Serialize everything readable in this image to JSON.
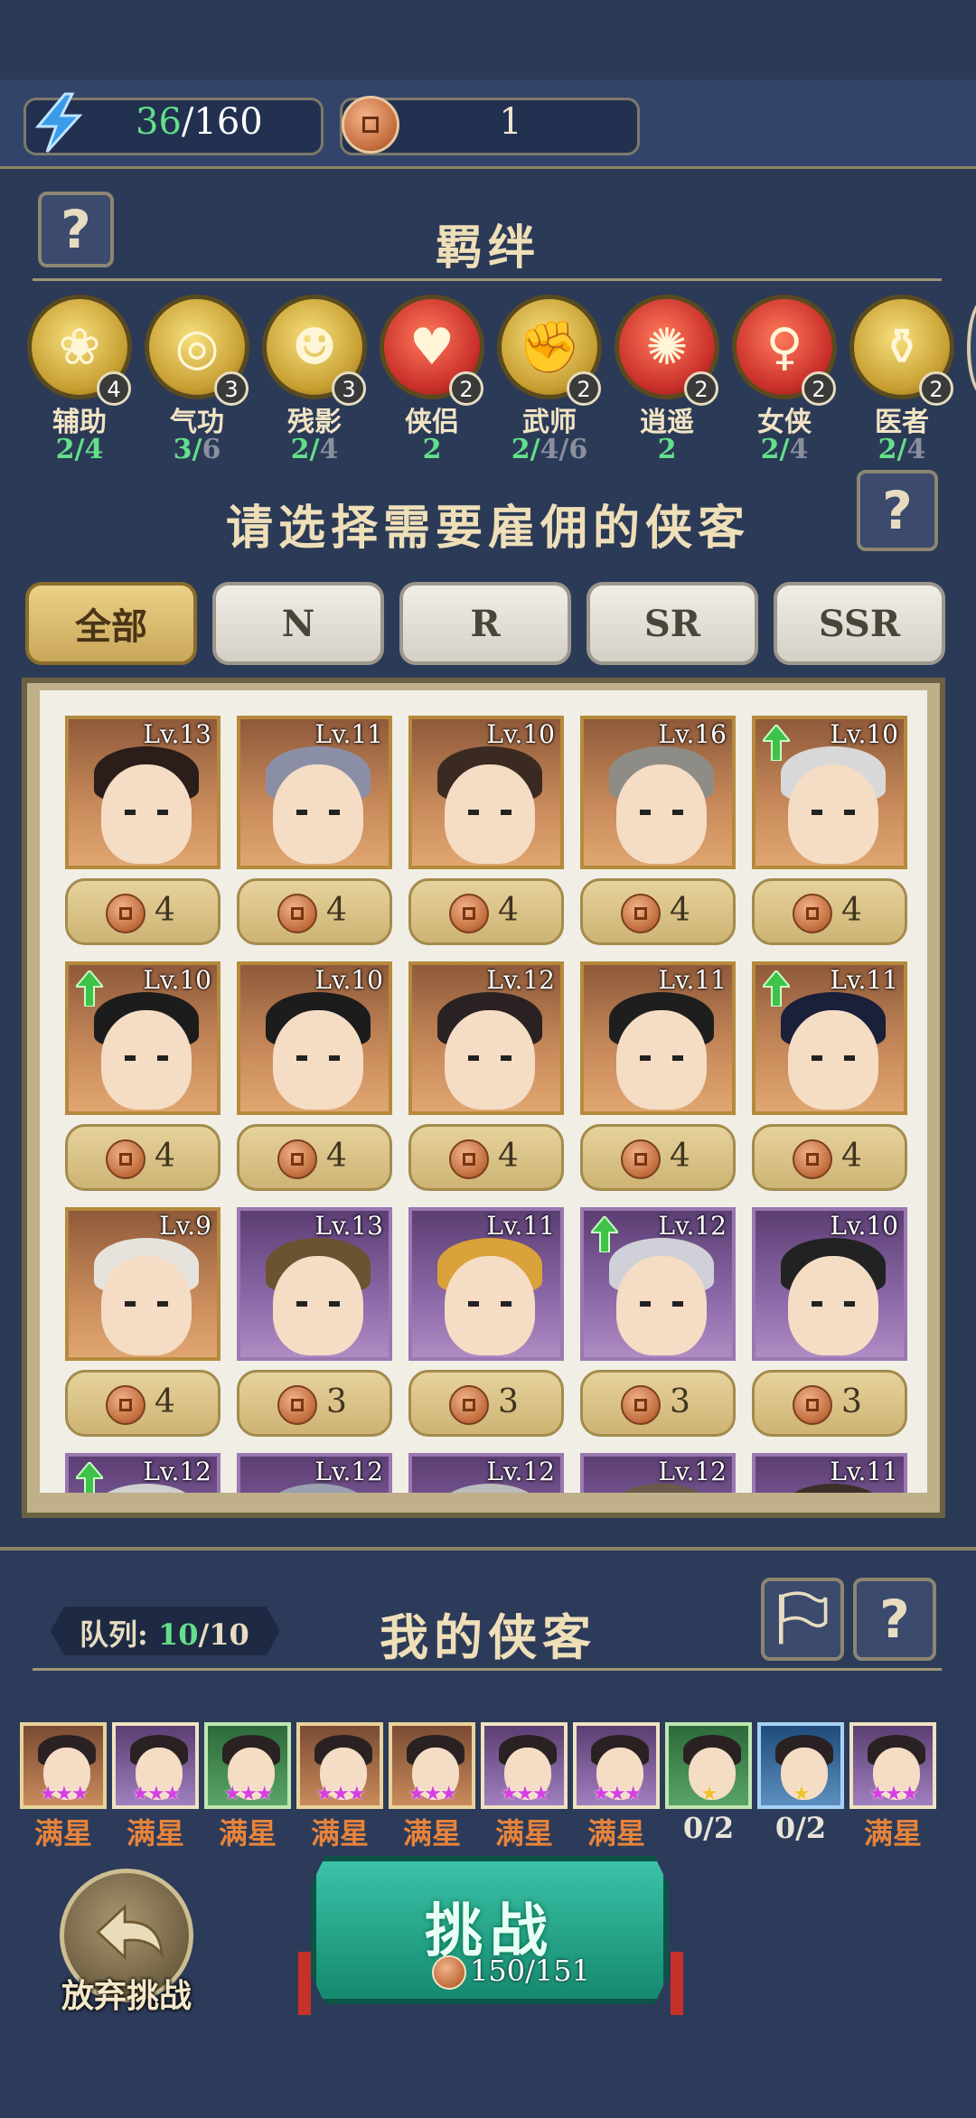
{
  "resources": {
    "energy_current": "36",
    "energy_max": "/160",
    "coins": "1"
  },
  "bonds": {
    "title": "羁绊",
    "items": [
      {
        "name": "辅助",
        "count": "4",
        "progress": "2/4",
        "dim": "",
        "color": "gold",
        "glyph": "❀"
      },
      {
        "name": "气功",
        "count": "3",
        "progress": "3/",
        "dim": "6",
        "color": "gold",
        "glyph": "◎"
      },
      {
        "name": "残影",
        "count": "3",
        "progress": "2/",
        "dim": "4",
        "color": "gold",
        "glyph": "☻"
      },
      {
        "name": "侠侣",
        "count": "2",
        "progress": "2",
        "dim": "",
        "color": "red",
        "glyph": "♥"
      },
      {
        "name": "武师",
        "count": "2",
        "progress": "2/",
        "dim": "4/6",
        "color": "gold",
        "glyph": "✊"
      },
      {
        "name": "逍遥",
        "count": "2",
        "progress": "2",
        "dim": "",
        "color": "red",
        "glyph": "✺"
      },
      {
        "name": "女侠",
        "count": "2",
        "progress": "2/",
        "dim": "4",
        "color": "red",
        "glyph": "♀"
      },
      {
        "name": "医者",
        "count": "2",
        "progress": "2/",
        "dim": "4",
        "color": "gold",
        "glyph": "⚱"
      }
    ]
  },
  "hire": {
    "title": "请选择需要雇佣的侠客",
    "tabs": [
      "全部",
      "N",
      "R",
      "SR",
      "SSR"
    ],
    "active_tab": "全部"
  },
  "heroes": [
    {
      "lv": "Lv.13",
      "price": "4",
      "rarity": "orange",
      "up": false,
      "hair": "#2a1d1a"
    },
    {
      "lv": "Lv.11",
      "price": "4",
      "rarity": "orange",
      "up": false,
      "hair": "#8b8fa6"
    },
    {
      "lv": "Lv.10",
      "price": "4",
      "rarity": "orange",
      "up": false,
      "hair": "#3a2a22"
    },
    {
      "lv": "Lv.16",
      "price": "4",
      "rarity": "orange",
      "up": false,
      "hair": "#8e8c86"
    },
    {
      "lv": "Lv.10",
      "price": "4",
      "rarity": "orange",
      "up": true,
      "hair": "#d8d8d8"
    },
    {
      "lv": "Lv.10",
      "price": "4",
      "rarity": "orange",
      "up": true,
      "hair": "#1c1c1c"
    },
    {
      "lv": "Lv.10",
      "price": "4",
      "rarity": "orange",
      "up": false,
      "hair": "#1c1c1c"
    },
    {
      "lv": "Lv.12",
      "price": "4",
      "rarity": "orange",
      "up": false,
      "hair": "#2a2222"
    },
    {
      "lv": "Lv.11",
      "price": "4",
      "rarity": "orange",
      "up": false,
      "hair": "#1e1e1e"
    },
    {
      "lv": "Lv.11",
      "price": "4",
      "rarity": "orange",
      "up": true,
      "hair": "#1a1f3a"
    },
    {
      "lv": "Lv.9",
      "price": "4",
      "rarity": "orange",
      "up": false,
      "hair": "#e6e3dc"
    },
    {
      "lv": "Lv.13",
      "price": "3",
      "rarity": "purple",
      "up": false,
      "hair": "#6b5230"
    },
    {
      "lv": "Lv.11",
      "price": "3",
      "rarity": "purple",
      "up": false,
      "hair": "#d9a23a"
    },
    {
      "lv": "Lv.12",
      "price": "3",
      "rarity": "purple",
      "up": true,
      "hair": "#cfd0d8"
    },
    {
      "lv": "Lv.10",
      "price": "3",
      "rarity": "purple",
      "up": false,
      "hair": "#222"
    },
    {
      "lv": "Lv.12",
      "price": "",
      "rarity": "purple",
      "up": true,
      "hair": "#cfcfcf"
    },
    {
      "lv": "Lv.12",
      "price": "",
      "rarity": "purple",
      "up": false,
      "hair": "#9aa0b0"
    },
    {
      "lv": "Lv.12",
      "price": "",
      "rarity": "purple",
      "up": false,
      "hair": "#bbbbbb"
    },
    {
      "lv": "Lv.12",
      "price": "",
      "rarity": "purple",
      "up": false,
      "hair": "#6b5a4a"
    },
    {
      "lv": "Lv.11",
      "price": "",
      "rarity": "purple",
      "up": false,
      "hair": "#3b2f28"
    }
  ],
  "my_heroes": {
    "title": "我的侠客",
    "queue_label": "队列:",
    "queue_current": "10",
    "queue_max": "/10",
    "items": [
      {
        "label": "满星",
        "stars": "★★★",
        "rarity": "orange",
        "star_color": "purple"
      },
      {
        "label": "满星",
        "stars": "★★★",
        "rarity": "purple",
        "star_color": "purple"
      },
      {
        "label": "满星",
        "stars": "★★★",
        "rarity": "green",
        "star_color": "purple"
      },
      {
        "label": "满星",
        "stars": "★★★",
        "rarity": "orange",
        "star_color": "purple"
      },
      {
        "label": "满星",
        "stars": "★★★",
        "rarity": "orange",
        "star_color": "purple"
      },
      {
        "label": "满星",
        "stars": "★★★",
        "rarity": "purple",
        "star_color": "purple"
      },
      {
        "label": "满星",
        "stars": "★★★",
        "rarity": "purple",
        "star_color": "purple"
      },
      {
        "label": "0/2",
        "stars": "★",
        "rarity": "green",
        "star_color": "gold"
      },
      {
        "label": "0/2",
        "stars": "★",
        "rarity": "blue",
        "star_color": "gold"
      },
      {
        "label": "满星",
        "stars": "★★★",
        "rarity": "purple",
        "star_color": "purple"
      }
    ]
  },
  "actions": {
    "give_up": "放弃挑战",
    "challenge": "挑战",
    "challenge_cost": "150/151"
  },
  "icons": {
    "help": "?",
    "energy": "lightning-icon",
    "coin": "copper-coin-icon",
    "flag": "flag-icon",
    "back": "return-arrow-icon"
  }
}
